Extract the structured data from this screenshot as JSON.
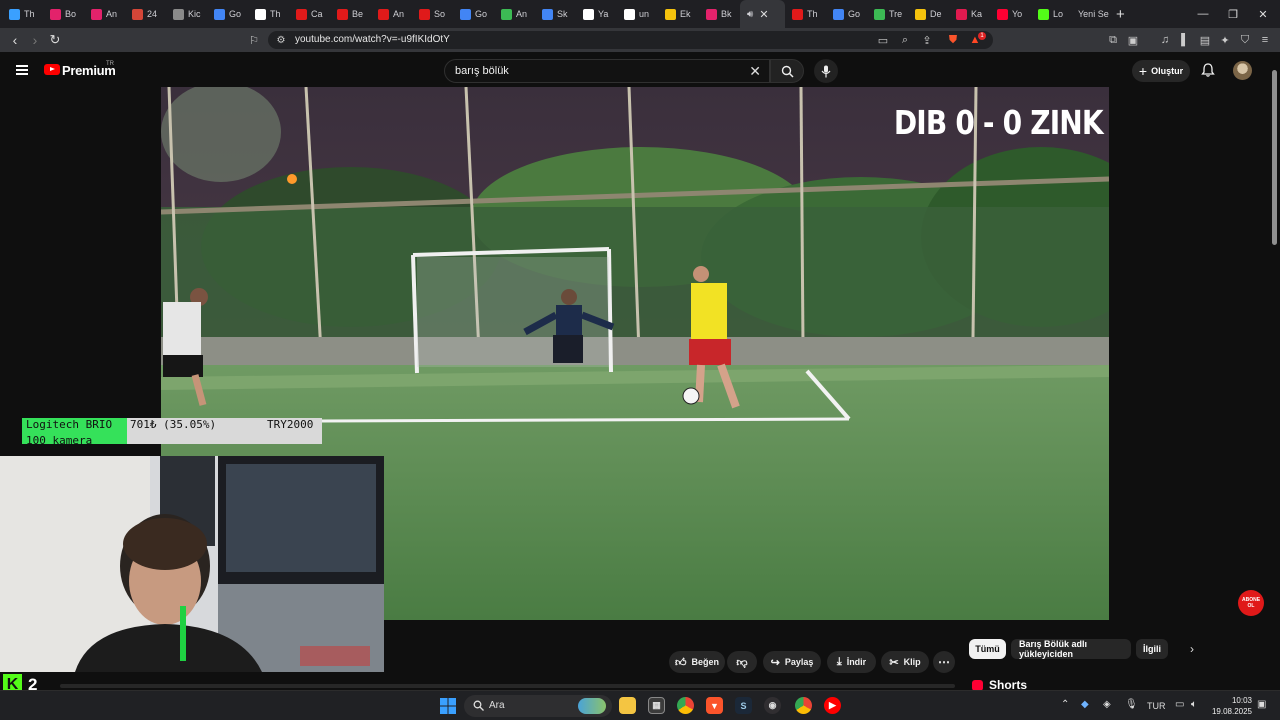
{
  "tabs": [
    {
      "label": "Th",
      "color": "#3aa0ff"
    },
    {
      "label": "Bo",
      "color": "#e3226b"
    },
    {
      "label": "An",
      "color": "#e3226b"
    },
    {
      "label": "24",
      "color": "#d44638"
    },
    {
      "label": "Kic",
      "color": "#8a8a8a"
    },
    {
      "label": "Go",
      "color": "#4285f4"
    },
    {
      "label": "Th",
      "color": "#ffffff"
    },
    {
      "label": "Ca",
      "color": "#e01a1a"
    },
    {
      "label": "Be",
      "color": "#e01a1a"
    },
    {
      "label": "An",
      "color": "#e01a1a"
    },
    {
      "label": "So",
      "color": "#e01a1a"
    },
    {
      "label": "Go",
      "color": "#4285f4"
    },
    {
      "label": "An",
      "color": "#3cba54"
    },
    {
      "label": "Sk",
      "color": "#4285f4"
    },
    {
      "label": "Ya",
      "color": "#ffffff"
    },
    {
      "label": "un",
      "color": "#ffffff"
    },
    {
      "label": "Ek",
      "color": "#f4c20d"
    },
    {
      "label": "Bk",
      "color": "#e3226b"
    }
  ],
  "active_tab": {
    "label": "",
    "icon": "speaker-icon"
  },
  "tabs_after": [
    {
      "label": "Th",
      "color": "#e01a1a"
    },
    {
      "label": "Go",
      "color": "#4285f4"
    },
    {
      "label": "Tre",
      "color": "#3cba54"
    },
    {
      "label": "De",
      "color": "#f4c20d"
    },
    {
      "label": "Ka",
      "color": "#e01a4f"
    },
    {
      "label": "Yo",
      "color": "#ff0033"
    },
    {
      "label": "Lo",
      "color": "#53fc18"
    }
  ],
  "new_tab_label": "Yeni Se",
  "url": "youtube.com/watch?v=-u9fIKIdOtY",
  "brave_badge": "1",
  "youtube": {
    "brand": "Premium",
    "region": "TR",
    "search_value": "barış bölük",
    "create_label": "Oluştur"
  },
  "video": {
    "scoreboard": "DIB 0 - 0 ZINK"
  },
  "donation": {
    "line1": "Logitech BRIO",
    "line2": "100 kamera",
    "amount": "701₺ (35.05%)",
    "goal": "TRY2000",
    "progress_fraction": 0.3505
  },
  "kick": {
    "logo": "K",
    "viewers": "2"
  },
  "actions": {
    "like": "Beğen",
    "share": "Paylaş",
    "download": "İndir",
    "clip": "Klip"
  },
  "chips": [
    "Tümü",
    "Barış Bölük adlı yükleyiciden",
    "İlgili"
  ],
  "shorts_label": "Shorts",
  "watermark": "ABONE OL",
  "taskbar": {
    "search_label": "Ara",
    "language": "TUR",
    "time": "10:03",
    "date": "19.08.2025"
  }
}
